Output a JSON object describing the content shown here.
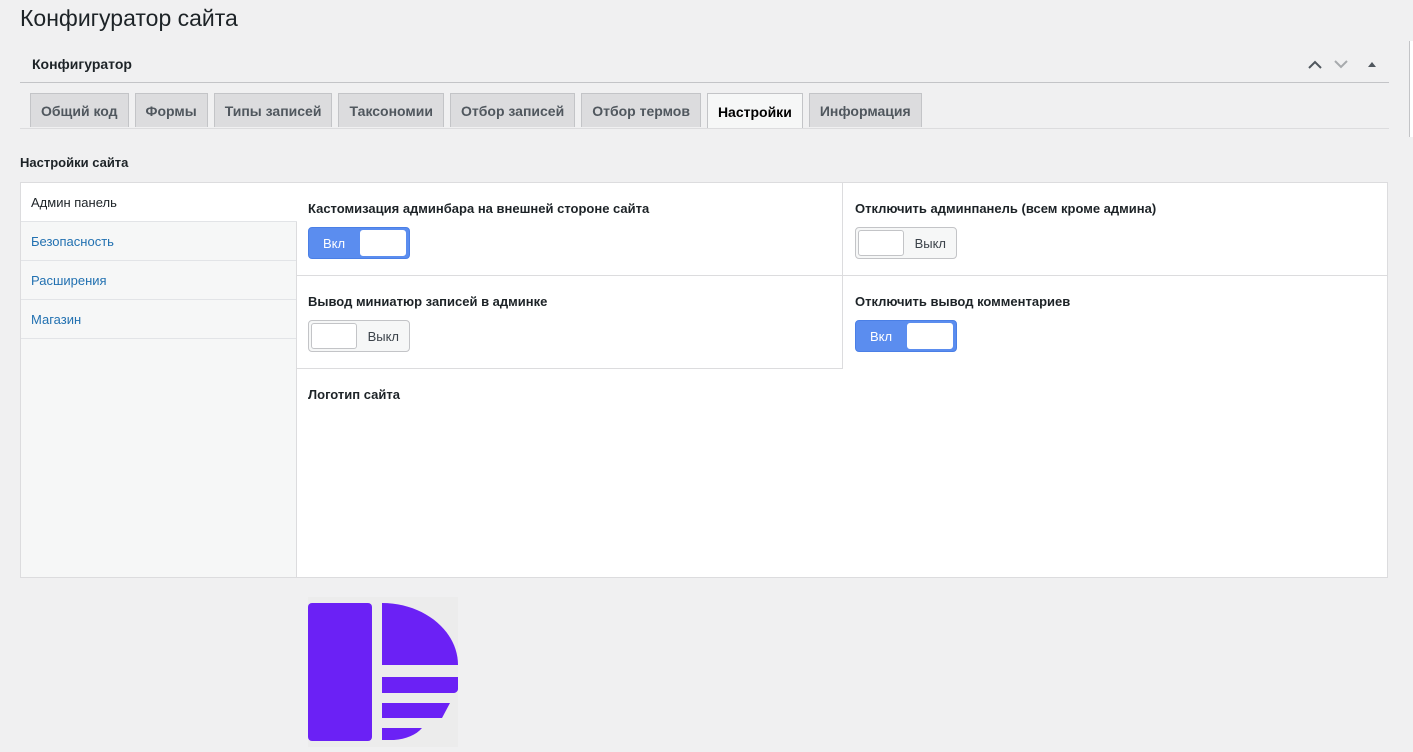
{
  "page": {
    "title": "Конфигуратор сайта"
  },
  "postbox": {
    "title": "Конфигуратор",
    "controls": {
      "move_up": "chevron-up-icon",
      "move_down": "chevron-down-icon",
      "toggle": "triangle-up-icon"
    }
  },
  "tabs": [
    {
      "label": "Общий код",
      "active": false
    },
    {
      "label": "Формы",
      "active": false
    },
    {
      "label": "Типы записей",
      "active": false
    },
    {
      "label": "Таксономии",
      "active": false
    },
    {
      "label": "Отбор записей",
      "active": false
    },
    {
      "label": "Отбор термов",
      "active": false
    },
    {
      "label": "Настройки",
      "active": true
    },
    {
      "label": "Информация",
      "active": false
    }
  ],
  "section": {
    "title": "Настройки сайта"
  },
  "sidebar": {
    "items": [
      {
        "label": "Админ панель",
        "active": true
      },
      {
        "label": "Безопасность",
        "active": false
      },
      {
        "label": "Расширения",
        "active": false
      },
      {
        "label": "Магазин",
        "active": false
      }
    ]
  },
  "fields": {
    "adminbar": {
      "label": "Кастомизация админбара на внешней стороне сайта",
      "state_label": "Вкл",
      "on": true
    },
    "disable_admin": {
      "label": "Отключить админпанель (всем кроме админа)",
      "state_label": "Выкл",
      "on": false
    },
    "thumbnails": {
      "label": "Вывод миниатюр записей в админке",
      "state_label": "Выкл",
      "on": false
    },
    "disable_comments": {
      "label": "Отключить вывод комментариев",
      "state_label": "Вкл",
      "on": true
    },
    "logo": {
      "label": "Логотип сайта",
      "color": "#6b21f5"
    }
  },
  "colors": {
    "accent": "#5b8def",
    "logo": "#6b21f5",
    "link": "#2271b1"
  }
}
